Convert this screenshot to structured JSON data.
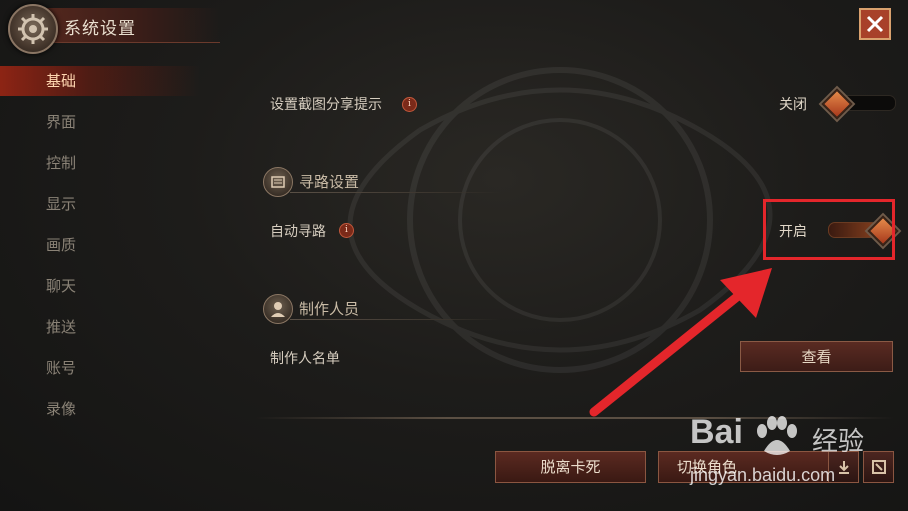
{
  "header": {
    "title": "系统设置"
  },
  "sidebar": {
    "items": [
      {
        "label": "基础",
        "active": true
      },
      {
        "label": "界面"
      },
      {
        "label": "控制"
      },
      {
        "label": "显示"
      },
      {
        "label": "画质"
      },
      {
        "label": "聊天"
      },
      {
        "label": "推送"
      },
      {
        "label": "账号"
      },
      {
        "label": "录像"
      }
    ]
  },
  "settings": {
    "screenshot_share": {
      "label": "设置截图分享提示",
      "state_label": "关闭",
      "on": false
    },
    "pathfinding_section": {
      "title": "寻路设置"
    },
    "auto_pathfinding": {
      "label": "自动寻路",
      "state_label": "开启",
      "on": true
    },
    "credits_section": {
      "title": "制作人员"
    },
    "credits_list": {
      "label": "制作人名单",
      "button_label": "查看"
    }
  },
  "bottom_bar": {
    "unstuck_label": "脱离卡死",
    "switch_role_label": "切换角色"
  },
  "watermark": {
    "brand": "Bai",
    "brand_suffix": "经验",
    "url": "jingyan.baidu.com"
  },
  "colors": {
    "accent": "#a8412a",
    "highlight": "#e4262b",
    "background": "#1d1c1a"
  }
}
